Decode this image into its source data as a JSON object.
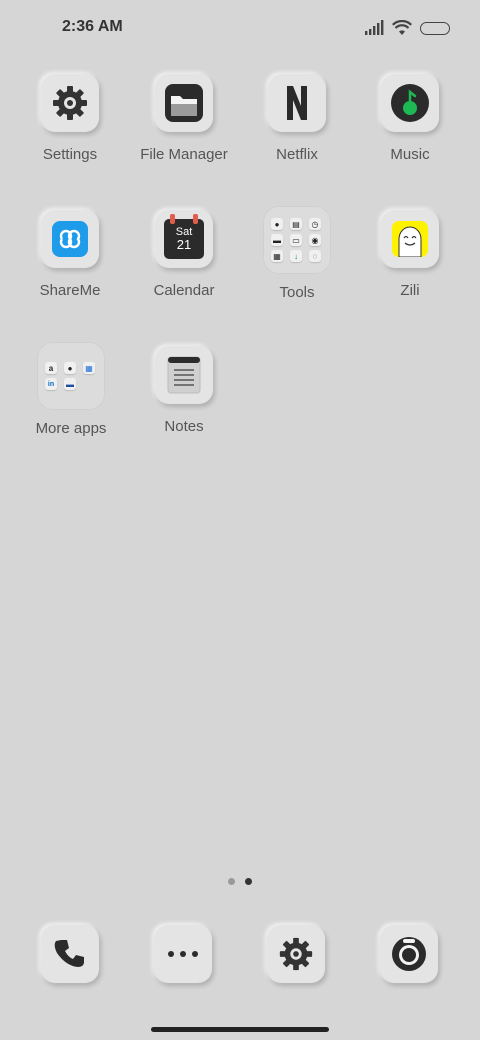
{
  "status_bar": {
    "time": "2:36 AM"
  },
  "apps": [
    {
      "name": "settings",
      "label": "Settings"
    },
    {
      "name": "file-manager",
      "label": "File Manager"
    },
    {
      "name": "netflix",
      "label": "Netflix",
      "glyph": "N"
    },
    {
      "name": "music",
      "label": "Music"
    },
    {
      "name": "shareme",
      "label": "ShareMe"
    },
    {
      "name": "calendar",
      "label": "Calendar",
      "day": "Sat",
      "date": "21"
    },
    {
      "name": "tools",
      "label": "Tools"
    },
    {
      "name": "zili",
      "label": "Zili"
    },
    {
      "name": "more-apps",
      "label": "More apps"
    },
    {
      "name": "notes",
      "label": "Notes"
    }
  ],
  "more_apps_folder": {
    "items": [
      "a",
      "●",
      "▦",
      "in",
      "▬"
    ]
  },
  "page_indicator": {
    "pages": 2,
    "active": 2
  },
  "dock": [
    "phone-icon",
    "more-icon",
    "settings-icon",
    "camera-icon"
  ],
  "colors": {
    "background": "#d6d6d6",
    "tile": "#e4e4e4",
    "shareme_blue": "#1e9be9",
    "music_green": "#1db954",
    "zili_yellow": "#fff200",
    "calendar_red": "#e25c4b"
  }
}
